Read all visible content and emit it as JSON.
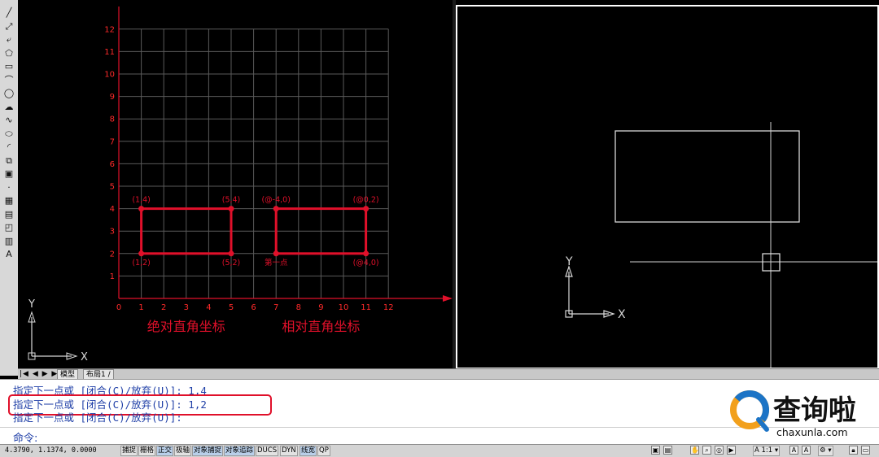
{
  "toolbar": {
    "tools": [
      {
        "name": "line-tool-icon",
        "glyph": "╱"
      },
      {
        "name": "construction-line-icon",
        "glyph": "⤢"
      },
      {
        "name": "polyline-icon",
        "glyph": "⤶"
      },
      {
        "name": "polygon-icon",
        "glyph": "⬠"
      },
      {
        "name": "rectangle-icon",
        "glyph": "▭"
      },
      {
        "name": "arc-icon",
        "glyph": "⌒"
      },
      {
        "name": "circle-icon",
        "glyph": "◯"
      },
      {
        "name": "revision-cloud-icon",
        "glyph": "☁"
      },
      {
        "name": "spline-icon",
        "glyph": "∿"
      },
      {
        "name": "ellipse-icon",
        "glyph": "⬭"
      },
      {
        "name": "ellipse-arc-icon",
        "glyph": "◜"
      },
      {
        "name": "insert-block-icon",
        "glyph": "⧉"
      },
      {
        "name": "make-block-icon",
        "glyph": "▣"
      },
      {
        "name": "point-icon",
        "glyph": "·"
      },
      {
        "name": "hatch-icon",
        "glyph": "▦"
      },
      {
        "name": "gradient-icon",
        "glyph": "▤"
      },
      {
        "name": "region-icon",
        "glyph": "◰"
      },
      {
        "name": "table-icon",
        "glyph": "▥"
      },
      {
        "name": "multiline-text-icon",
        "glyph": "A"
      }
    ]
  },
  "grid": {
    "x_ticks": [
      "0",
      "1",
      "2",
      "3",
      "4",
      "5",
      "6",
      "7",
      "8",
      "9",
      "10",
      "11",
      "12"
    ],
    "y_ticks": [
      "1",
      "2",
      "3",
      "4",
      "5",
      "6",
      "7",
      "8",
      "9",
      "10",
      "11",
      "12"
    ],
    "caption_absolute": "绝对直角坐标",
    "caption_relative": "相对直角坐标",
    "abs_rect": {
      "x1": 1,
      "y1": 2,
      "x2": 5,
      "y2": 4
    },
    "rel_rect": {
      "x1": 7,
      "y1": 2,
      "x2": 11,
      "y2": 4
    },
    "points": [
      {
        "x": 1,
        "y": 4,
        "label": "(1,4)",
        "pos": "above"
      },
      {
        "x": 5,
        "y": 4,
        "label": "(5,4)",
        "pos": "above"
      },
      {
        "x": 1,
        "y": 2,
        "label": "(1,2)",
        "pos": "below"
      },
      {
        "x": 5,
        "y": 2,
        "label": "(5,2)",
        "pos": "below"
      },
      {
        "x": 7,
        "y": 4,
        "label": "(@-4,0)",
        "pos": "above"
      },
      {
        "x": 11,
        "y": 4,
        "label": "(@0,2)",
        "pos": "above"
      },
      {
        "x": 7,
        "y": 2,
        "label": "第一点",
        "pos": "below"
      },
      {
        "x": 11,
        "y": 2,
        "label": "(@4,0)",
        "pos": "below"
      }
    ]
  },
  "ucs": {
    "x": "X",
    "y": "Y"
  },
  "tabs": {
    "nav": "|◀ ◀ ▶ ▶|",
    "model": "模型",
    "layout1": "布局1 /"
  },
  "command": {
    "line1": "指定下一点或 [闭合(C)/放弃(U)]: 1,4",
    "line2": "指定下一点或 [闭合(C)/放弃(U)]: 1,2",
    "line3": "指定下一点或 [闭合(C)/放弃(U)]:",
    "prompt": "命令:"
  },
  "logo": {
    "cn": "查询啦",
    "url": "chaxunla.com"
  },
  "status": {
    "coords": "4.3790, 1.1374, 0.0000",
    "buttons": [
      {
        "label": "捕捉",
        "on": false
      },
      {
        "label": "栅格",
        "on": false
      },
      {
        "label": "正交",
        "on": true
      },
      {
        "label": "极轴",
        "on": false
      },
      {
        "label": "对象捕捉",
        "on": true
      },
      {
        "label": "对象追踪",
        "on": true
      },
      {
        "label": "DUCS",
        "on": false
      },
      {
        "label": "DYN",
        "on": false
      },
      {
        "label": "线宽",
        "on": true
      },
      {
        "label": "QP",
        "on": false
      }
    ],
    "scale": "A 1:1 ▾",
    "workspace": "⚙ ▾"
  },
  "colors": {
    "red": "#e0102a",
    "grid": "#5a5a5a",
    "axis_text": "#ff2a2a"
  }
}
